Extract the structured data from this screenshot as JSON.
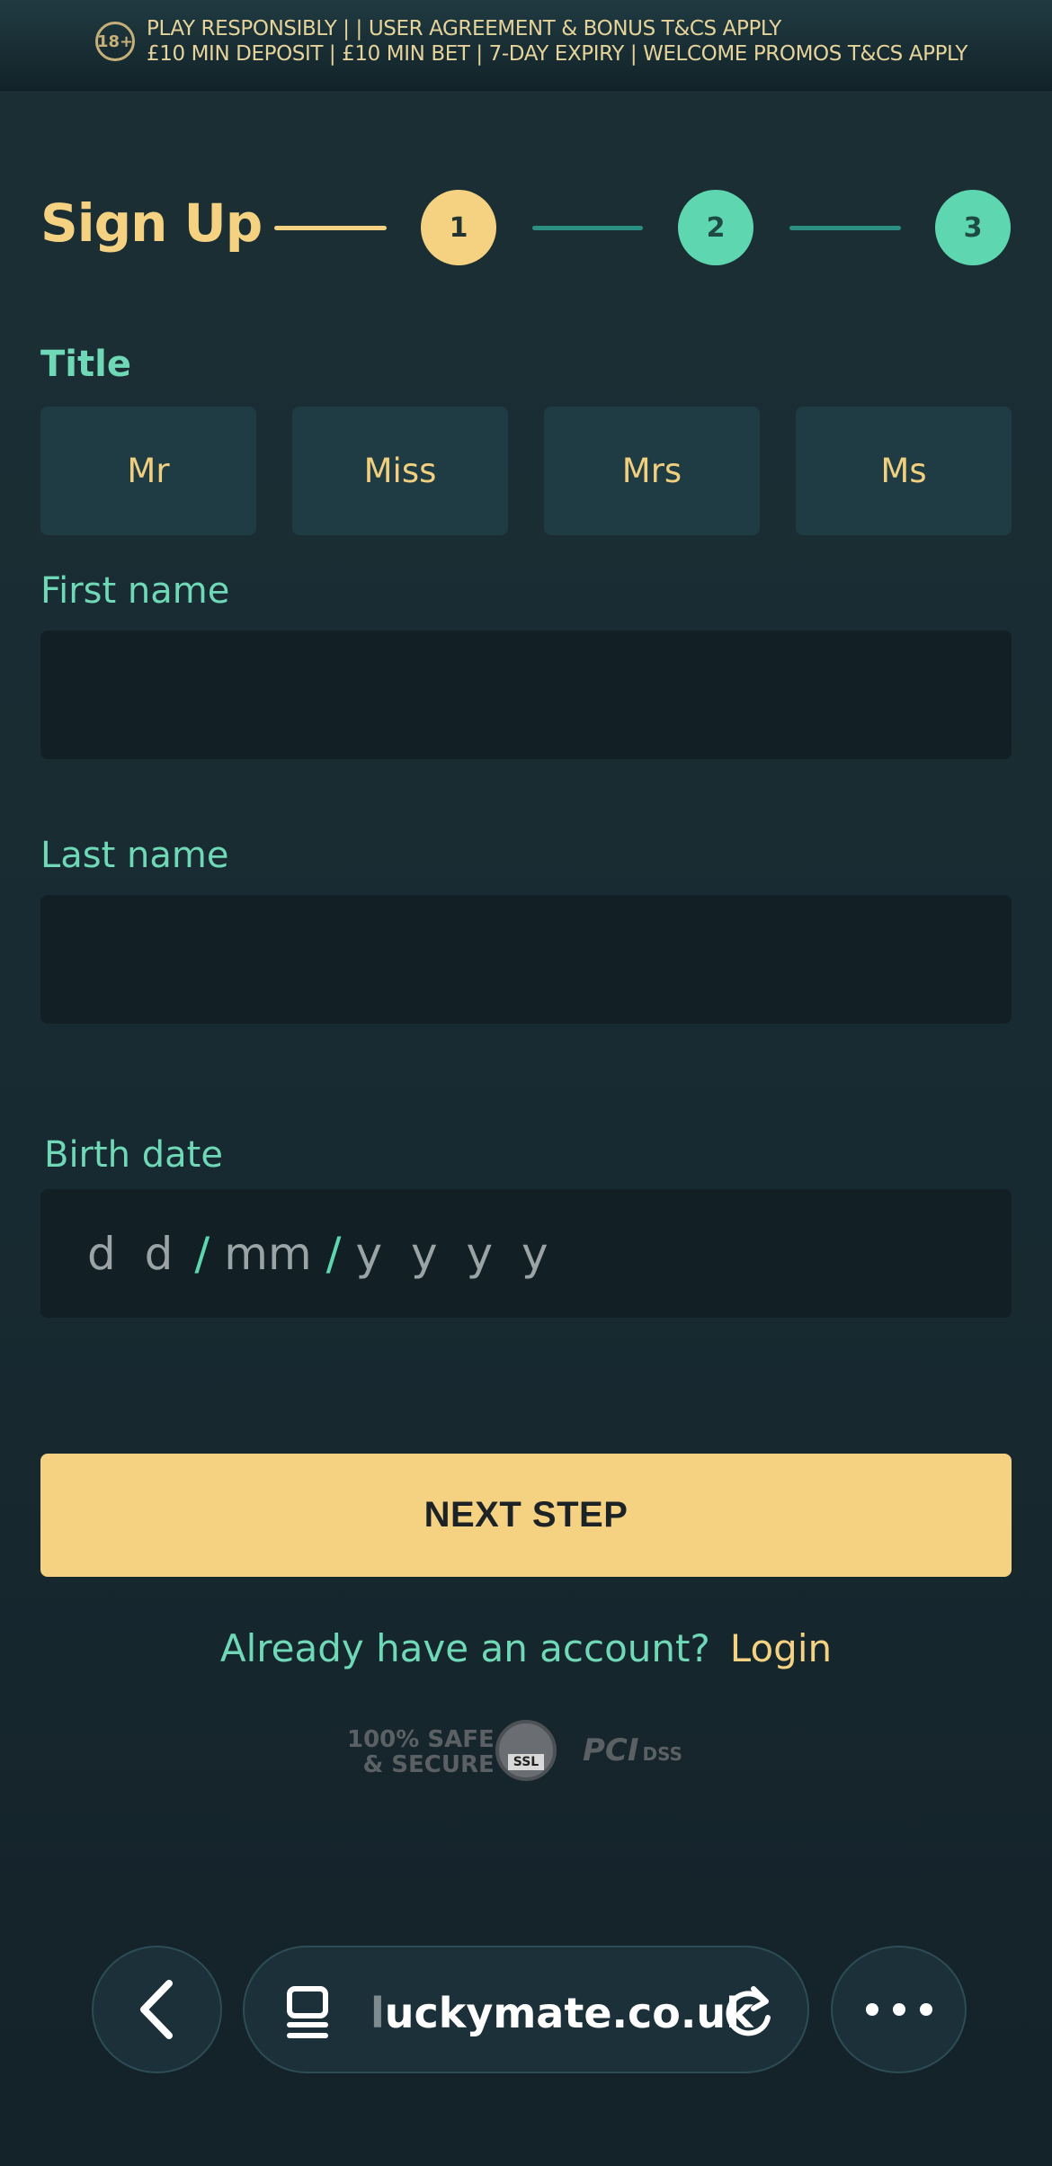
{
  "banner": {
    "age_badge": "18+",
    "line1": "PLAY RESPONSIBLY | | USER AGREEMENT & BONUS T&CS APPLY",
    "line2": "£10 MIN DEPOSIT | £10 MIN BET | 7-DAY EXPIRY | WELCOME PROMOS T&CS APPLY"
  },
  "header": {
    "title": "Sign Up",
    "steps": [
      "1",
      "2",
      "3"
    ],
    "active_step": 1
  },
  "form": {
    "title_label": "Title",
    "title_options": [
      "Mr",
      "Miss",
      "Mrs",
      "Ms"
    ],
    "first_name_label": "First name",
    "first_name_value": "",
    "last_name_label": "Last name",
    "last_name_value": "",
    "birth_date_label": "Birth date",
    "birth_date_placeholder": {
      "day": "d d",
      "month": "mm",
      "year": "y y y y",
      "separator": "/"
    },
    "next_label": "NEXT STEP",
    "already_text": "Already have an account?",
    "login_link": "Login"
  },
  "badges": {
    "safe_line1": "100% SAFE",
    "safe_line2": "& SECURE",
    "ssl": "SSL",
    "pci": "PCI",
    "dss": "DSS"
  },
  "browser": {
    "url_faded": "l",
    "url": "uckymate.co.uk"
  },
  "colors": {
    "accent_gold": "#f4d281",
    "accent_teal": "#5ed6b0",
    "label_teal": "#6fd8b7",
    "background": "#1b2f35",
    "input_bg": "#121f24",
    "option_bg": "#1f3c44"
  }
}
